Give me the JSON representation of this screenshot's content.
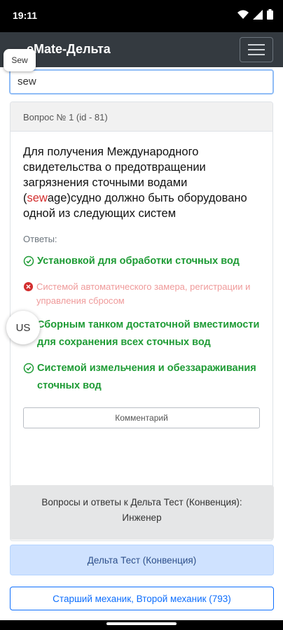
{
  "status": {
    "time": "19:11"
  },
  "app": {
    "title": "eMate-Дельта"
  },
  "search": {
    "value": "sew",
    "chip": "Sew"
  },
  "question": {
    "header": "Вопрос № 1 (id - 81)",
    "text_before": "Для получения Международного свидетельства о предотвращении загрязнения сточными водами (",
    "highlight": "sew",
    "text_after": "age)судно должно быть оборудовано одной из следующих систем",
    "answers_label": "Ответы:",
    "answers": [
      {
        "text": "Установкой для обработки сточных вод",
        "correct": true
      },
      {
        "text": "Системой автоматического замера, регистрации и управления сбросом",
        "correct": false
      },
      {
        "text": "Сборным танком достаточной вместимости для сохранения всех сточных вод",
        "correct": true
      },
      {
        "text": "Системой измельчения и обеззараживания сточных вод",
        "correct": true
      }
    ],
    "comment_button": "Комментарий"
  },
  "floating": {
    "us": "US"
  },
  "info": {
    "line1": "Вопросы и ответы к Дельта Тест (Конвенция):",
    "line2": "Инженер"
  },
  "buttons": {
    "test": "Дельта Тест (Конвенция)",
    "mechanic": "Старший механик, Второй механик (793)"
  },
  "colors": {
    "correct": "#1e9b35",
    "wrong": "#ef9a9a",
    "highlight": "#d32f2f",
    "appbar": "#343a40"
  }
}
